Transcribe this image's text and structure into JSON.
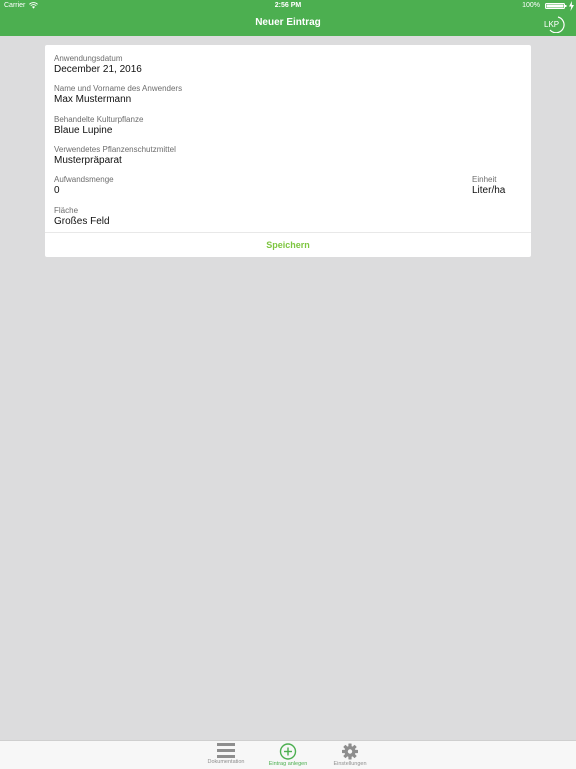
{
  "status_bar": {
    "carrier": "Carrier",
    "time": "2:56 PM",
    "battery": "100%"
  },
  "header": {
    "title": "Neuer Eintrag",
    "logo_text": "LKP",
    "logo_icon": "lkp-logo-icon"
  },
  "form": {
    "fields": [
      {
        "label": "Anwendungsdatum",
        "value": "December 21, 2016"
      },
      {
        "label": "Name und Vorname des Anwenders",
        "value": "Max Mustermann"
      },
      {
        "label": "Behandelte Kulturpflanze",
        "value": "Blaue Lupine"
      },
      {
        "label": "Verwendetes Pflanzenschutzmittel",
        "value": "Musterpräparat"
      },
      {
        "label": "Aufwandsmenge",
        "value": "0"
      },
      {
        "label": "Fläche",
        "value": "Großes Feld"
      }
    ],
    "unit": {
      "label": "Einheit",
      "value": "Liter/ha"
    },
    "save_label": "Speichern"
  },
  "tabbar": {
    "tabs": [
      {
        "label": "Dokumentation",
        "icon": "list-icon"
      },
      {
        "label": "Eintrag anlegen",
        "icon": "add-circle-icon"
      },
      {
        "label": "Einstellungen",
        "icon": "gear-icon"
      }
    ],
    "active_index": 1
  },
  "colors": {
    "header_bg": "#4caf50",
    "accent": "#7ec640",
    "background": "#dcdcdd"
  }
}
